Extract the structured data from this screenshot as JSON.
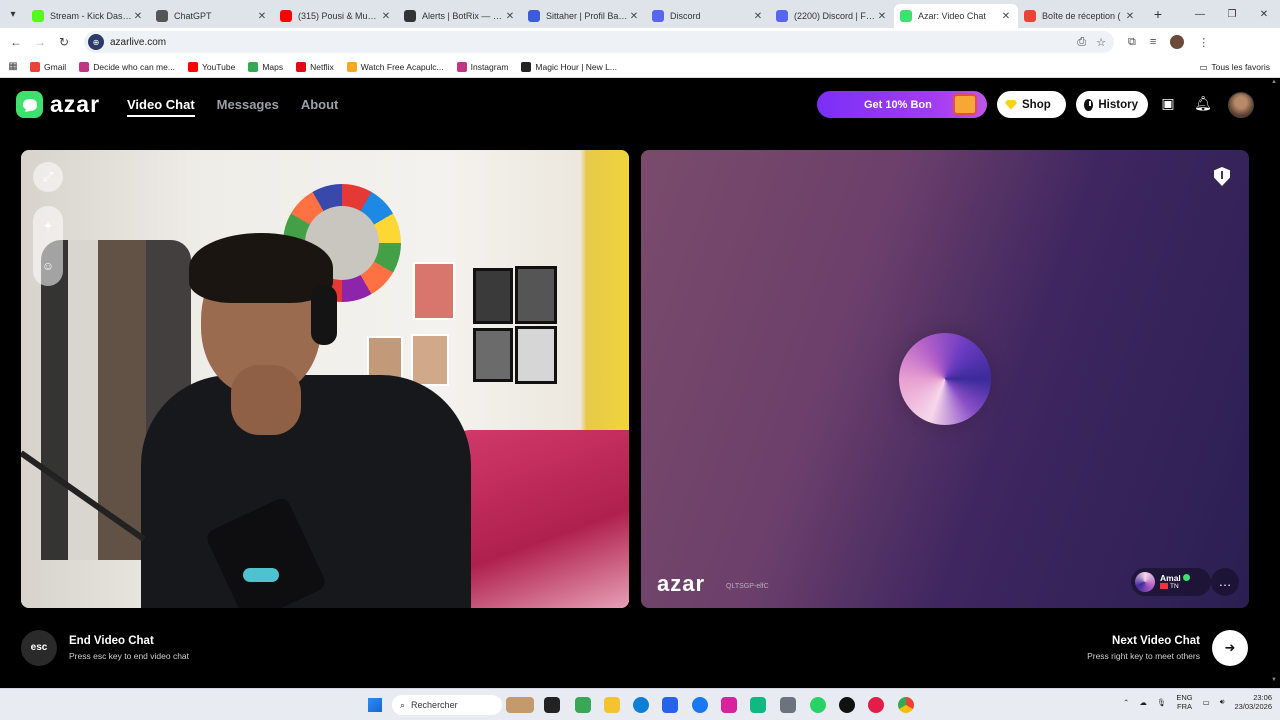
{
  "browser": {
    "tabs": [
      {
        "title": "Stream - Kick Dashbo",
        "color": "#53fc18",
        "active": false
      },
      {
        "title": "ChatGPT",
        "color": "#555555",
        "active": false
      },
      {
        "title": "(315) Pousi & Muslim",
        "color": "#ff0000",
        "active": false
      },
      {
        "title": "Alerts | BotRix — Clo",
        "color": "#333333",
        "active": false
      },
      {
        "title": "Sittaher | Profil Bakch",
        "color": "#3b5bdb",
        "active": false
      },
      {
        "title": "Discord",
        "color": "#5865f2",
        "active": false
      },
      {
        "title": "(2200) Discord | Frier",
        "color": "#5865f2",
        "active": false
      },
      {
        "title": "Azar: Video Chat",
        "color": "#3ee06e",
        "active": true
      },
      {
        "title": "Boîte de réception (",
        "color": "#ea4335",
        "active": false
      }
    ],
    "url": "azarlive.com",
    "bookmarks": [
      {
        "label": "Gmail",
        "color": "#ea4335"
      },
      {
        "label": "Decide who can me...",
        "color": "#c13584"
      },
      {
        "label": "YouTube",
        "color": "#ff0000"
      },
      {
        "label": "Maps",
        "color": "#34a853"
      },
      {
        "label": "Netflix",
        "color": "#e50914"
      },
      {
        "label": "Watch Free Acapulc...",
        "color": "#f5a623"
      },
      {
        "label": "Instagram",
        "color": "#c13584"
      },
      {
        "label": "Magic Hour | New L...",
        "color": "#222222"
      }
    ],
    "all_bookmarks_label": "Tous les favoris"
  },
  "app": {
    "logo_text": "azar",
    "nav": {
      "video_chat": "Video Chat",
      "messages": "Messages",
      "about": "About"
    },
    "promo_label": "Get 10% Bon",
    "shop_label": "Shop",
    "history_label": "History",
    "accent": "#3ee06e",
    "promo_color": "#8a35f4"
  },
  "left_panel": {
    "expand_icon": "expand-icon",
    "tools": [
      "magic-wand-icon",
      "face-filter-icon"
    ]
  },
  "right_panel": {
    "watermark": "azar",
    "room_id": "QLTSGP-elfC",
    "partner_name": "Amal",
    "partner_country": "TN"
  },
  "controls": {
    "esc_key": "esc",
    "end_title": "End Video Chat",
    "end_sub": "Press esc key to end video chat",
    "next_title": "Next Video Chat",
    "next_sub": "Press right key to meet others"
  },
  "taskbar": {
    "search_label": "Rechercher",
    "lang_top": "ENG",
    "lang_bottom": "FRA",
    "time": "23:06",
    "date": "23/03/2026",
    "badges": {
      "mail": "7",
      "whatsapp": "11",
      "chrome": "1"
    }
  }
}
